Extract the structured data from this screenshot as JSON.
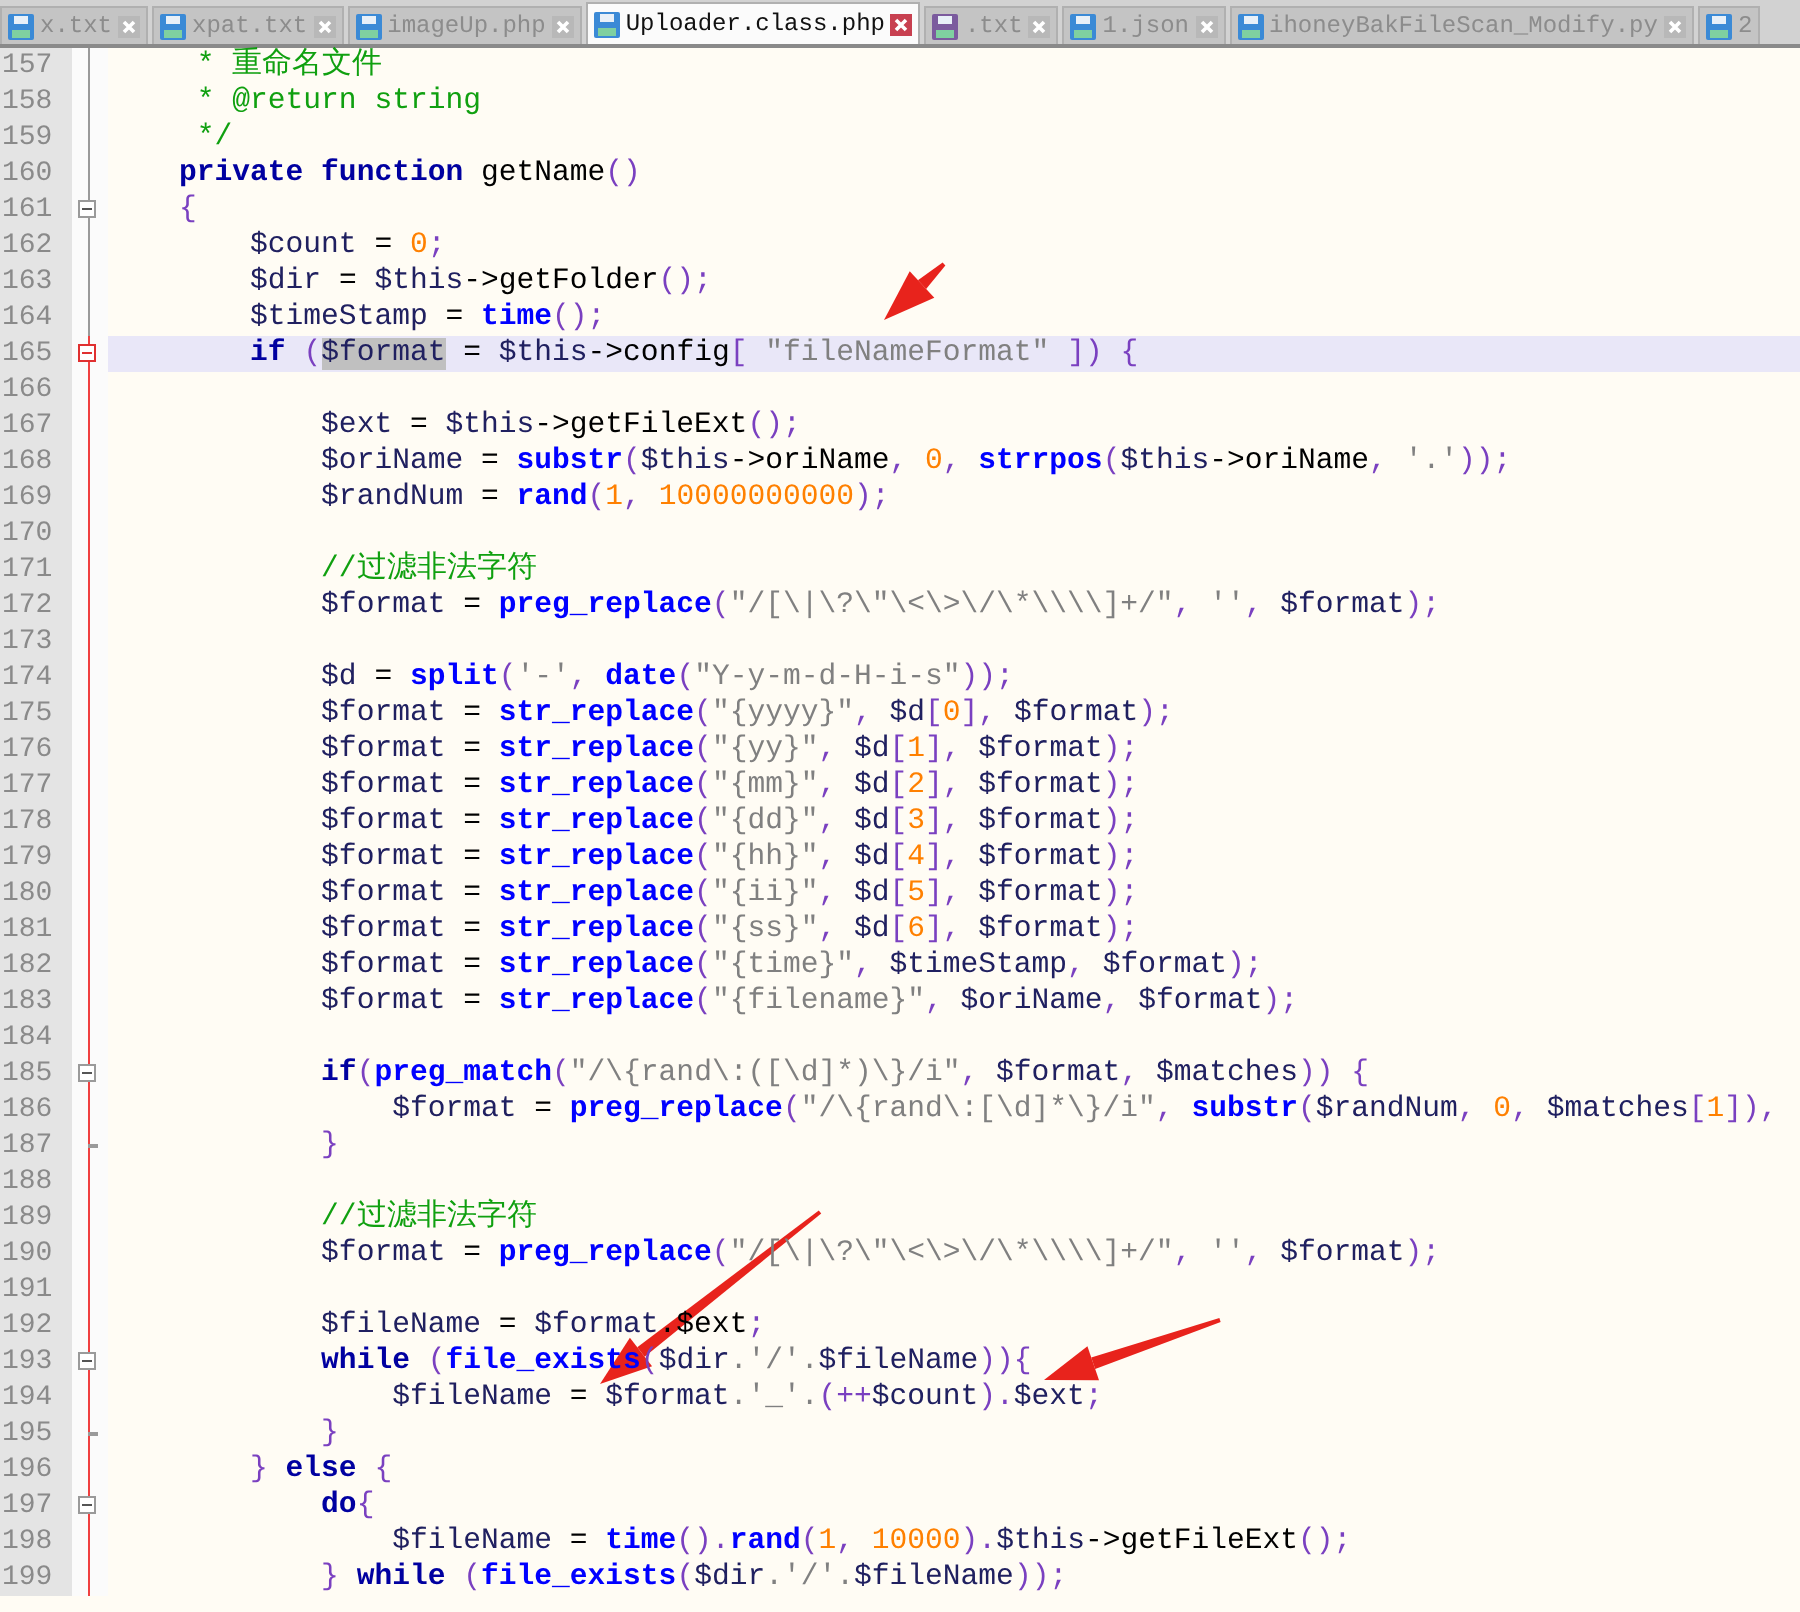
{
  "tabs": [
    {
      "label": "x.txt",
      "selected": false,
      "color": "#3b8ad6"
    },
    {
      "label": "xpat.txt",
      "selected": false,
      "color": "#3b8ad6"
    },
    {
      "label": "imageUp.php",
      "selected": false,
      "color": "#3b8ad6"
    },
    {
      "label": "Uploader.class.php",
      "selected": true,
      "color": "#3b8ad6"
    },
    {
      "label": ".txt",
      "selected": false,
      "color": "#7b5b9e"
    },
    {
      "label": "1.json",
      "selected": false,
      "color": "#3b8ad6"
    },
    {
      "label": "ihoneyBakFileScan_Modify.py",
      "selected": false,
      "color": "#3b8ad6"
    },
    {
      "label": "2",
      "selected": false,
      "color": "#3b8ad6"
    }
  ],
  "lines": [
    {
      "number": "157",
      "kind": "plain",
      "current": false,
      "segments": [
        {
          "kind": "c",
          "text": "     * 重命名文件"
        }
      ]
    },
    {
      "number": "158",
      "kind": "plain",
      "current": false,
      "segments": [
        {
          "kind": "c",
          "text": "     * @return string"
        }
      ]
    },
    {
      "number": "159",
      "kind": "plain",
      "current": false,
      "segments": [
        {
          "kind": "c",
          "text": "     */"
        }
      ]
    },
    {
      "number": "160",
      "kind": "plain",
      "current": false,
      "segments": [
        {
          "kind": "k",
          "text": "    private function"
        },
        {
          "kind": "t",
          "text": " getName"
        },
        {
          "kind": "p",
          "text": "()"
        }
      ]
    },
    {
      "number": "161",
      "kind": "fold_start",
      "current": false,
      "segments": [
        {
          "kind": "p",
          "text": "    {"
        }
      ]
    },
    {
      "number": "162",
      "kind": "plain",
      "current": false,
      "segments": [
        {
          "kind": "v",
          "text": "        $count"
        },
        {
          "kind": "t",
          "text": " = "
        },
        {
          "kind": "n",
          "text": "0"
        },
        {
          "kind": "p",
          "text": ";"
        }
      ]
    },
    {
      "number": "163",
      "kind": "plain",
      "current": false,
      "segments": [
        {
          "kind": "v",
          "text": "        $dir"
        },
        {
          "kind": "t",
          "text": " = "
        },
        {
          "kind": "v",
          "text": "$this"
        },
        {
          "kind": "t",
          "text": "->getFolder"
        },
        {
          "kind": "p",
          "text": "();"
        }
      ]
    },
    {
      "number": "164",
      "kind": "plain",
      "current": false,
      "segments": [
        {
          "kind": "v",
          "text": "        $timeStamp"
        },
        {
          "kind": "t",
          "text": " = "
        },
        {
          "kind": "f",
          "text": "time"
        },
        {
          "kind": "p",
          "text": "();"
        }
      ]
    },
    {
      "number": "165",
      "kind": "fold_start",
      "current": true,
      "segments": [
        {
          "kind": "k",
          "text": "        if "
        },
        {
          "kind": "p",
          "text": "("
        },
        {
          "kind": "h",
          "text": "$format"
        },
        {
          "kind": "t",
          "text": " = "
        },
        {
          "kind": "v",
          "text": "$this"
        },
        {
          "kind": "t",
          "text": "->config"
        },
        {
          "kind": "p",
          "text": "[ "
        },
        {
          "kind": "s",
          "text": "\"fileNameFormat\""
        },
        {
          "kind": "p",
          "text": " ]) {"
        }
      ]
    },
    {
      "number": "166",
      "kind": "plain",
      "current": false
    },
    {
      "number": "167",
      "kind": "plain",
      "current": false,
      "segments": [
        {
          "kind": "v",
          "text": "            $ext"
        },
        {
          "kind": "t",
          "text": " = "
        },
        {
          "kind": "v",
          "text": "$this"
        },
        {
          "kind": "t",
          "text": "->getFileExt"
        },
        {
          "kind": "p",
          "text": "();"
        }
      ]
    },
    {
      "number": "168",
      "kind": "plain",
      "current": false,
      "segments": [
        {
          "kind": "v",
          "text": "            $oriName"
        },
        {
          "kind": "t",
          "text": " = "
        },
        {
          "kind": "f",
          "text": "substr"
        },
        {
          "kind": "p",
          "text": "("
        },
        {
          "kind": "v",
          "text": "$this"
        },
        {
          "kind": "t",
          "text": "->oriName"
        },
        {
          "kind": "p",
          "text": ", "
        },
        {
          "kind": "n",
          "text": "0"
        },
        {
          "kind": "p",
          "text": ", "
        },
        {
          "kind": "f",
          "text": "strrpos"
        },
        {
          "kind": "p",
          "text": "("
        },
        {
          "kind": "v",
          "text": "$this"
        },
        {
          "kind": "t",
          "text": "->oriName"
        },
        {
          "kind": "p",
          "text": ", "
        },
        {
          "kind": "s",
          "text": "'.'"
        },
        {
          "kind": "p",
          "text": "));"
        }
      ]
    },
    {
      "number": "169",
      "kind": "plain",
      "current": false,
      "segments": [
        {
          "kind": "v",
          "text": "            $randNum"
        },
        {
          "kind": "t",
          "text": " = "
        },
        {
          "kind": "f",
          "text": "rand"
        },
        {
          "kind": "p",
          "text": "("
        },
        {
          "kind": "n",
          "text": "1"
        },
        {
          "kind": "p",
          "text": ", "
        },
        {
          "kind": "n",
          "text": "10000000000"
        },
        {
          "kind": "p",
          "text": ");"
        }
      ]
    },
    {
      "number": "170",
      "kind": "plain",
      "current": false
    },
    {
      "number": "171",
      "kind": "plain",
      "current": false,
      "segments": [
        {
          "kind": "c",
          "text": "            //过滤非法字符"
        }
      ]
    },
    {
      "number": "172",
      "kind": "plain",
      "current": false,
      "segments": [
        {
          "kind": "v",
          "text": "            $format"
        },
        {
          "kind": "t",
          "text": " = "
        },
        {
          "kind": "f",
          "text": "preg_replace"
        },
        {
          "kind": "p",
          "text": "("
        },
        {
          "kind": "s",
          "text": "\"/[\\|\\?\\\"\\<\\>\\/\\*\\\\\\\\]+/\""
        },
        {
          "kind": "p",
          "text": ", "
        },
        {
          "kind": "s",
          "text": "''"
        },
        {
          "kind": "p",
          "text": ", "
        },
        {
          "kind": "v",
          "text": "$format"
        },
        {
          "kind": "p",
          "text": ");"
        }
      ]
    },
    {
      "number": "173",
      "kind": "plain",
      "current": false
    },
    {
      "number": "174",
      "kind": "plain",
      "current": false,
      "segments": [
        {
          "kind": "v",
          "text": "            $d"
        },
        {
          "kind": "t",
          "text": " = "
        },
        {
          "kind": "f",
          "text": "split"
        },
        {
          "kind": "p",
          "text": "("
        },
        {
          "kind": "s",
          "text": "'-'"
        },
        {
          "kind": "p",
          "text": ", "
        },
        {
          "kind": "f",
          "text": "date"
        },
        {
          "kind": "p",
          "text": "("
        },
        {
          "kind": "s",
          "text": "\"Y-y-m-d-H-i-s\""
        },
        {
          "kind": "p",
          "text": "));"
        }
      ]
    },
    {
      "number": "175",
      "kind": "plain",
      "current": false,
      "segments": [
        {
          "kind": "v",
          "text": "            $format"
        },
        {
          "kind": "t",
          "text": " = "
        },
        {
          "kind": "f",
          "text": "str_replace"
        },
        {
          "kind": "p",
          "text": "("
        },
        {
          "kind": "s",
          "text": "\"{yyyy}\""
        },
        {
          "kind": "p",
          "text": ", "
        },
        {
          "kind": "v",
          "text": "$d"
        },
        {
          "kind": "p",
          "text": "["
        },
        {
          "kind": "n",
          "text": "0"
        },
        {
          "kind": "p",
          "text": "], "
        },
        {
          "kind": "v",
          "text": "$format"
        },
        {
          "kind": "p",
          "text": ");"
        }
      ]
    },
    {
      "number": "176",
      "kind": "plain",
      "current": false,
      "segments": [
        {
          "kind": "v",
          "text": "            $format"
        },
        {
          "kind": "t",
          "text": " = "
        },
        {
          "kind": "f",
          "text": "str_replace"
        },
        {
          "kind": "p",
          "text": "("
        },
        {
          "kind": "s",
          "text": "\"{yy}\""
        },
        {
          "kind": "p",
          "text": ", "
        },
        {
          "kind": "v",
          "text": "$d"
        },
        {
          "kind": "p",
          "text": "["
        },
        {
          "kind": "n",
          "text": "1"
        },
        {
          "kind": "p",
          "text": "], "
        },
        {
          "kind": "v",
          "text": "$format"
        },
        {
          "kind": "p",
          "text": ");"
        }
      ]
    },
    {
      "number": "177",
      "kind": "plain",
      "current": false,
      "segments": [
        {
          "kind": "v",
          "text": "            $format"
        },
        {
          "kind": "t",
          "text": " = "
        },
        {
          "kind": "f",
          "text": "str_replace"
        },
        {
          "kind": "p",
          "text": "("
        },
        {
          "kind": "s",
          "text": "\"{mm}\""
        },
        {
          "kind": "p",
          "text": ", "
        },
        {
          "kind": "v",
          "text": "$d"
        },
        {
          "kind": "p",
          "text": "["
        },
        {
          "kind": "n",
          "text": "2"
        },
        {
          "kind": "p",
          "text": "], "
        },
        {
          "kind": "v",
          "text": "$format"
        },
        {
          "kind": "p",
          "text": ");"
        }
      ]
    },
    {
      "number": "178",
      "kind": "plain",
      "current": false,
      "segments": [
        {
          "kind": "v",
          "text": "            $format"
        },
        {
          "kind": "t",
          "text": " = "
        },
        {
          "kind": "f",
          "text": "str_replace"
        },
        {
          "kind": "p",
          "text": "("
        },
        {
          "kind": "s",
          "text": "\"{dd}\""
        },
        {
          "kind": "p",
          "text": ", "
        },
        {
          "kind": "v",
          "text": "$d"
        },
        {
          "kind": "p",
          "text": "["
        },
        {
          "kind": "n",
          "text": "3"
        },
        {
          "kind": "p",
          "text": "], "
        },
        {
          "kind": "v",
          "text": "$format"
        },
        {
          "kind": "p",
          "text": ");"
        }
      ]
    },
    {
      "number": "179",
      "kind": "plain",
      "current": false,
      "segments": [
        {
          "kind": "v",
          "text": "            $format"
        },
        {
          "kind": "t",
          "text": " = "
        },
        {
          "kind": "f",
          "text": "str_replace"
        },
        {
          "kind": "p",
          "text": "("
        },
        {
          "kind": "s",
          "text": "\"{hh}\""
        },
        {
          "kind": "p",
          "text": ", "
        },
        {
          "kind": "v",
          "text": "$d"
        },
        {
          "kind": "p",
          "text": "["
        },
        {
          "kind": "n",
          "text": "4"
        },
        {
          "kind": "p",
          "text": "], "
        },
        {
          "kind": "v",
          "text": "$format"
        },
        {
          "kind": "p",
          "text": ");"
        }
      ]
    },
    {
      "number": "180",
      "kind": "plain",
      "current": false,
      "segments": [
        {
          "kind": "v",
          "text": "            $format"
        },
        {
          "kind": "t",
          "text": " = "
        },
        {
          "kind": "f",
          "text": "str_replace"
        },
        {
          "kind": "p",
          "text": "("
        },
        {
          "kind": "s",
          "text": "\"{ii}\""
        },
        {
          "kind": "p",
          "text": ", "
        },
        {
          "kind": "v",
          "text": "$d"
        },
        {
          "kind": "p",
          "text": "["
        },
        {
          "kind": "n",
          "text": "5"
        },
        {
          "kind": "p",
          "text": "], "
        },
        {
          "kind": "v",
          "text": "$format"
        },
        {
          "kind": "p",
          "text": ");"
        }
      ]
    },
    {
      "number": "181",
      "kind": "plain",
      "current": false,
      "segments": [
        {
          "kind": "v",
          "text": "            $format"
        },
        {
          "kind": "t",
          "text": " = "
        },
        {
          "kind": "f",
          "text": "str_replace"
        },
        {
          "kind": "p",
          "text": "("
        },
        {
          "kind": "s",
          "text": "\"{ss}\""
        },
        {
          "kind": "p",
          "text": ", "
        },
        {
          "kind": "v",
          "text": "$d"
        },
        {
          "kind": "p",
          "text": "["
        },
        {
          "kind": "n",
          "text": "6"
        },
        {
          "kind": "p",
          "text": "], "
        },
        {
          "kind": "v",
          "text": "$format"
        },
        {
          "kind": "p",
          "text": ");"
        }
      ]
    },
    {
      "number": "182",
      "kind": "plain",
      "current": false,
      "segments": [
        {
          "kind": "v",
          "text": "            $format"
        },
        {
          "kind": "t",
          "text": " = "
        },
        {
          "kind": "f",
          "text": "str_replace"
        },
        {
          "kind": "p",
          "text": "("
        },
        {
          "kind": "s",
          "text": "\"{time}\""
        },
        {
          "kind": "p",
          "text": ", "
        },
        {
          "kind": "v",
          "text": "$timeStamp"
        },
        {
          "kind": "p",
          "text": ", "
        },
        {
          "kind": "v",
          "text": "$format"
        },
        {
          "kind": "p",
          "text": ");"
        }
      ]
    },
    {
      "number": "183",
      "kind": "plain",
      "current": false,
      "segments": [
        {
          "kind": "v",
          "text": "            $format"
        },
        {
          "kind": "t",
          "text": " = "
        },
        {
          "kind": "f",
          "text": "str_replace"
        },
        {
          "kind": "p",
          "text": "("
        },
        {
          "kind": "s",
          "text": "\"{filename}\""
        },
        {
          "kind": "p",
          "text": ", "
        },
        {
          "kind": "v",
          "text": "$oriName"
        },
        {
          "kind": "p",
          "text": ", "
        },
        {
          "kind": "v",
          "text": "$format"
        },
        {
          "kind": "p",
          "text": ");"
        }
      ]
    },
    {
      "number": "184",
      "kind": "plain",
      "current": false
    },
    {
      "number": "185",
      "kind": "fold_start",
      "current": false,
      "segments": [
        {
          "kind": "k",
          "text": "            if"
        },
        {
          "kind": "p",
          "text": "("
        },
        {
          "kind": "f",
          "text": "preg_match"
        },
        {
          "kind": "p",
          "text": "("
        },
        {
          "kind": "s",
          "text": "\"/\\{rand\\:([\\d]*)\\}/i\""
        },
        {
          "kind": "p",
          "text": ", "
        },
        {
          "kind": "v",
          "text": "$format"
        },
        {
          "kind": "p",
          "text": ", "
        },
        {
          "kind": "v",
          "text": "$matches"
        },
        {
          "kind": "p",
          "text": ")) {"
        }
      ]
    },
    {
      "number": "186",
      "kind": "plain",
      "current": false,
      "segments": [
        {
          "kind": "v",
          "text": "                $format"
        },
        {
          "kind": "t",
          "text": " = "
        },
        {
          "kind": "f",
          "text": "preg_replace"
        },
        {
          "kind": "p",
          "text": "("
        },
        {
          "kind": "s",
          "text": "\"/\\{rand\\:[\\d]*\\}/i\""
        },
        {
          "kind": "p",
          "text": ", "
        },
        {
          "kind": "f",
          "text": "substr"
        },
        {
          "kind": "p",
          "text": "("
        },
        {
          "kind": "v",
          "text": "$randNum"
        },
        {
          "kind": "p",
          "text": ", "
        },
        {
          "kind": "n",
          "text": "0"
        },
        {
          "kind": "p",
          "text": ", "
        },
        {
          "kind": "v",
          "text": "$matches"
        },
        {
          "kind": "p",
          "text": "["
        },
        {
          "kind": "n",
          "text": "1"
        },
        {
          "kind": "p",
          "text": "]),"
        }
      ]
    },
    {
      "number": "187",
      "kind": "fold_end",
      "current": false,
      "segments": [
        {
          "kind": "p",
          "text": "            }"
        }
      ]
    },
    {
      "number": "188",
      "kind": "plain",
      "current": false
    },
    {
      "number": "189",
      "kind": "plain",
      "current": false,
      "segments": [
        {
          "kind": "c",
          "text": "            //过滤非法字符"
        }
      ]
    },
    {
      "number": "190",
      "kind": "plain",
      "current": false,
      "segments": [
        {
          "kind": "v",
          "text": "            $format"
        },
        {
          "kind": "t",
          "text": " = "
        },
        {
          "kind": "f",
          "text": "preg_replace"
        },
        {
          "kind": "p",
          "text": "("
        },
        {
          "kind": "s",
          "text": "\"/[\\|\\?\\\"\\<\\>\\/\\*\\\\\\\\]+/\""
        },
        {
          "kind": "p",
          "text": ", "
        },
        {
          "kind": "s",
          "text": "''"
        },
        {
          "kind": "p",
          "text": ", "
        },
        {
          "kind": "v",
          "text": "$format"
        },
        {
          "kind": "p",
          "text": ");"
        }
      ]
    },
    {
      "number": "191",
      "kind": "plain",
      "current": false
    },
    {
      "number": "192",
      "kind": "plain",
      "current": false,
      "segments": [
        {
          "kind": "v",
          "text": "            $fileName"
        },
        {
          "kind": "t",
          "text": " = "
        },
        {
          "kind": "v",
          "text": "$format"
        },
        {
          "kind": "t",
          "text": ".$ext"
        },
        {
          "kind": "p",
          "text": ";"
        }
      ]
    },
    {
      "number": "193",
      "kind": "fold_start",
      "current": false,
      "segments": [
        {
          "kind": "k",
          "text": "            while "
        },
        {
          "kind": "p",
          "text": "("
        },
        {
          "kind": "f",
          "text": "file_exists"
        },
        {
          "kind": "p",
          "text": "("
        },
        {
          "kind": "v",
          "text": "$dir"
        },
        {
          "kind": "s",
          "text": ".'/'."
        },
        {
          "kind": "v",
          "text": "$fileName"
        },
        {
          "kind": "p",
          "text": ")){"
        }
      ]
    },
    {
      "number": "194",
      "kind": "plain",
      "current": false,
      "segments": [
        {
          "kind": "v",
          "text": "                $fileName"
        },
        {
          "kind": "t",
          "text": " = "
        },
        {
          "kind": "v",
          "text": "$format"
        },
        {
          "kind": "s",
          "text": ".'_'."
        },
        {
          "kind": "p",
          "text": "(++"
        },
        {
          "kind": "v",
          "text": "$count"
        },
        {
          "kind": "p",
          "text": ")."
        },
        {
          "kind": "v",
          "text": "$ext"
        },
        {
          "kind": "p",
          "text": ";"
        }
      ]
    },
    {
      "number": "195",
      "kind": "fold_end",
      "current": false,
      "segments": [
        {
          "kind": "p",
          "text": "            }"
        }
      ]
    },
    {
      "number": "196",
      "kind": "plain",
      "current": false,
      "segments": [
        {
          "kind": "p",
          "text": "        } "
        },
        {
          "kind": "k",
          "text": "else"
        },
        {
          "kind": "p",
          "text": " {"
        }
      ]
    },
    {
      "number": "197",
      "kind": "fold_start",
      "current": false,
      "segments": [
        {
          "kind": "k",
          "text": "            do"
        },
        {
          "kind": "p",
          "text": "{"
        }
      ]
    },
    {
      "number": "198",
      "kind": "plain",
      "current": false,
      "segments": [
        {
          "kind": "v",
          "text": "                $fileName"
        },
        {
          "kind": "t",
          "text": " = "
        },
        {
          "kind": "f",
          "text": "time"
        },
        {
          "kind": "p",
          "text": "()."
        },
        {
          "kind": "f",
          "text": "rand"
        },
        {
          "kind": "p",
          "text": "("
        },
        {
          "kind": "n",
          "text": "1"
        },
        {
          "kind": "p",
          "text": ", "
        },
        {
          "kind": "n",
          "text": "10000"
        },
        {
          "kind": "p",
          "text": ")."
        },
        {
          "kind": "v",
          "text": "$this"
        },
        {
          "kind": "t",
          "text": "->getFileExt"
        },
        {
          "kind": "p",
          "text": "();"
        }
      ]
    },
    {
      "number": "199",
      "kind": "plain",
      "current": false,
      "segments": [
        {
          "kind": "p",
          "text": "            } "
        },
        {
          "kind": "k",
          "text": "while "
        },
        {
          "kind": "p",
          "text": "("
        },
        {
          "kind": "f",
          "text": "file_exists"
        },
        {
          "kind": "p",
          "text": "("
        },
        {
          "kind": "v",
          "text": "$dir"
        },
        {
          "kind": "s",
          "text": ".'/'."
        },
        {
          "kind": "v",
          "text": "$fileName"
        },
        {
          "kind": "p",
          "text": "));"
        }
      ]
    }
  ]
}
